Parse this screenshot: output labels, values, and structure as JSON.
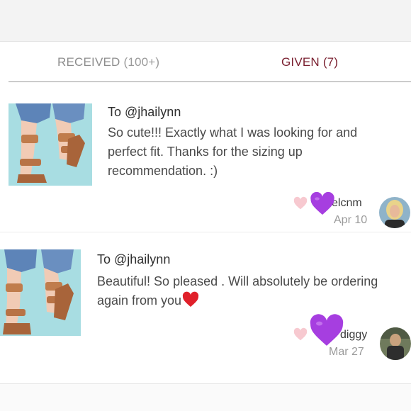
{
  "tabs": {
    "received_label": "RECEIVED",
    "received_count": "(100+)",
    "given_label": "GIVEN (7)"
  },
  "reviews": [
    {
      "to": "To @jhailynn",
      "message": "So cute!!! Exactly what I was looking for and perfect fit. Thanks for the sizing up recommendation. :)",
      "username": "elcnm",
      "date": "Apr 10"
    },
    {
      "to": "To @jhailynn",
      "message": "Beautiful! So pleased . Will absolutely be ordering again from you",
      "username": "diggy",
      "date": "Mar 27"
    }
  ],
  "colors": {
    "given_tab": "#7a2030",
    "like_heart": "#f7c9d0",
    "purple_heart": "#a63ee0",
    "red_heart": "#e0202a"
  },
  "icons": {
    "like": "heart-icon",
    "emoji_purple_heart": "purple-heart-emoji-icon",
    "emoji_red_heart": "red-heart-emoji-icon"
  }
}
